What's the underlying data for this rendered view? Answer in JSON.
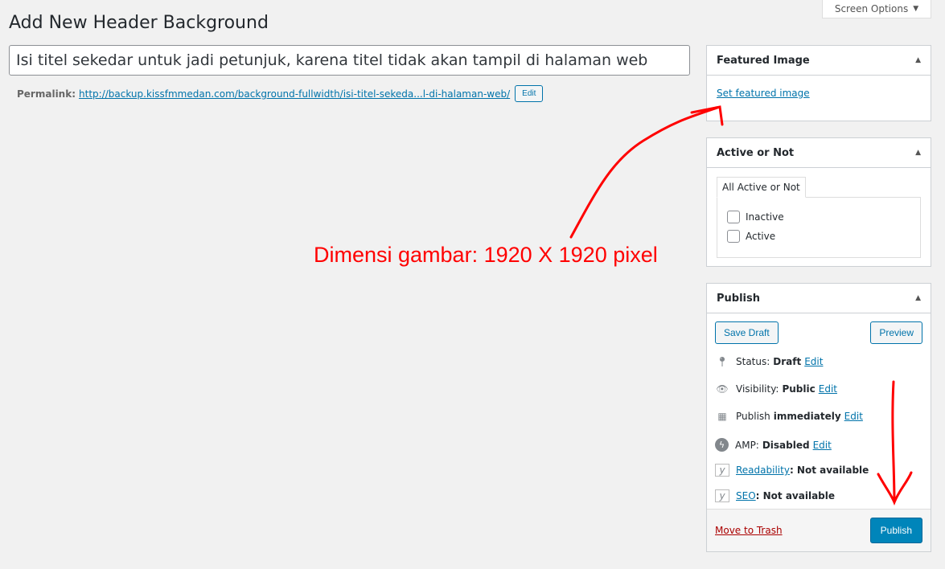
{
  "screen_options": "Screen Options",
  "page_title": "Add New Header Background",
  "title_value": "Isi titel sekedar untuk jadi petunjuk, karena titel tidak akan tampil di halaman web",
  "permalink": {
    "label": "Permalink:",
    "url": "http://backup.kissfmmedan.com/background-fullwidth/isi-titel-sekeda...l-di-halaman-web/",
    "edit": "Edit"
  },
  "featured": {
    "title": "Featured Image",
    "link": "Set featured image"
  },
  "active": {
    "title": "Active or Not",
    "tab": "All Active or Not",
    "options": [
      "Inactive",
      "Active"
    ]
  },
  "publish": {
    "title": "Publish",
    "save_draft": "Save Draft",
    "preview": "Preview",
    "status": {
      "label": "Status:",
      "value": "Draft",
      "edit": "Edit"
    },
    "visibility": {
      "label": "Visibility:",
      "value": "Public",
      "edit": "Edit"
    },
    "schedule": {
      "label": "Publish",
      "value": "immediately",
      "edit": "Edit"
    },
    "amp": {
      "label": "AMP:",
      "value": "Disabled",
      "edit": "Edit"
    },
    "readability": {
      "link": "Readability",
      "value": ": Not available"
    },
    "seo": {
      "link": "SEO",
      "value": ": Not available"
    },
    "trash": "Move to Trash",
    "publish_btn": "Publish"
  },
  "annotation": "Dimensi gambar: 1920 X 1920 pixel",
  "annotation_color": "#ff0000"
}
